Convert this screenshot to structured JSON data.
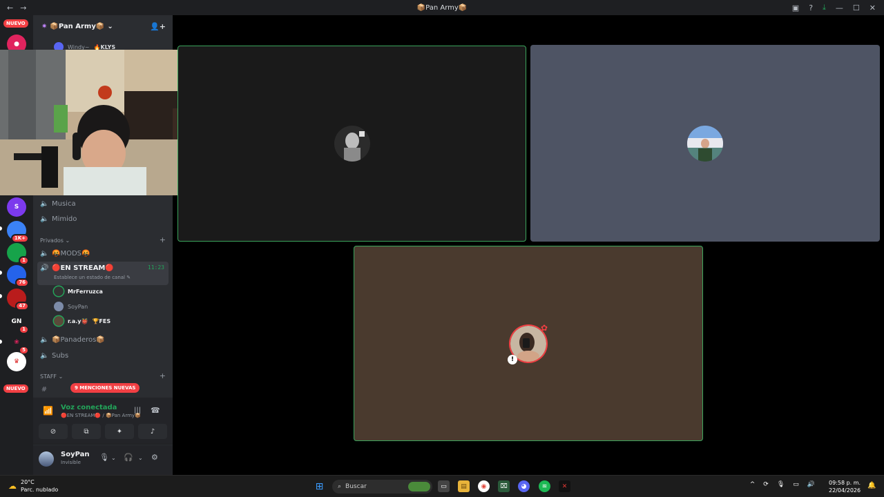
{
  "titlebar": {
    "back": "←",
    "forward": "→",
    "title": "📦Pan Army📦"
  },
  "guilds": {
    "nuevo_top": "NUEVO",
    "nuevo_bottom": "NUEVO",
    "items": [
      {
        "label": "",
        "badge": "",
        "color": "#e0245e"
      },
      {
        "label": "S",
        "badge": "",
        "color": "#7c3aed"
      },
      {
        "label": "",
        "badge": "1K+",
        "color": "#3b82f6"
      },
      {
        "label": "",
        "badge": "1",
        "color": "#16a34a"
      },
      {
        "label": "",
        "badge": "76",
        "color": "#2563eb"
      },
      {
        "label": "",
        "badge": "47",
        "color": "#b91c1c"
      },
      {
        "label": "GN",
        "badge": "1",
        "color": "#1e1f22"
      },
      {
        "label": "",
        "badge": "5",
        "color": "#1e1f22"
      },
      {
        "label": "",
        "badge": "",
        "color": "#ffffff"
      }
    ]
  },
  "server": {
    "name": "📦Pan Army📦",
    "top_user": "Windy~",
    "top_user_tag": "🔥KLYS",
    "channels": [
      {
        "name": "Musica"
      },
      {
        "name": "Mimido"
      }
    ],
    "cat_privados": "Privados",
    "mods": "🤬MODS🤬",
    "active_channel": "🔴EN STREAM🔴",
    "active_status": "Establece un estado de canal",
    "active_timer": "11:23",
    "voice_users": [
      {
        "name": "MrFerruzca"
      },
      {
        "name": "SoyPan"
      },
      {
        "name": "r.a.y👹",
        "tag": "🏆FES"
      }
    ],
    "channels2": [
      {
        "name": "📦Panaderos📦"
      },
      {
        "name": "Subs"
      }
    ],
    "cat_staff": "STAFF",
    "mentions": "9 MENCIONES NUEVAS"
  },
  "voice_panel": {
    "status": "Voz conectada",
    "location": "🔴EN STREAM🔴 / 📦Pan Army📦"
  },
  "user_panel": {
    "name": "SoyPan",
    "status": "Invisible"
  },
  "taskbar": {
    "temp": "20°C",
    "weather": "Parc. nublado",
    "search_placeholder": "Buscar",
    "time": "09:58 p. m.",
    "date": "22/04/2026"
  },
  "colors": {
    "speaking_green": "#3ba55c",
    "tile_dark": "#1a1a1a",
    "tile_gray": "#4e5464",
    "tile_brown": "#4a3a2e"
  }
}
